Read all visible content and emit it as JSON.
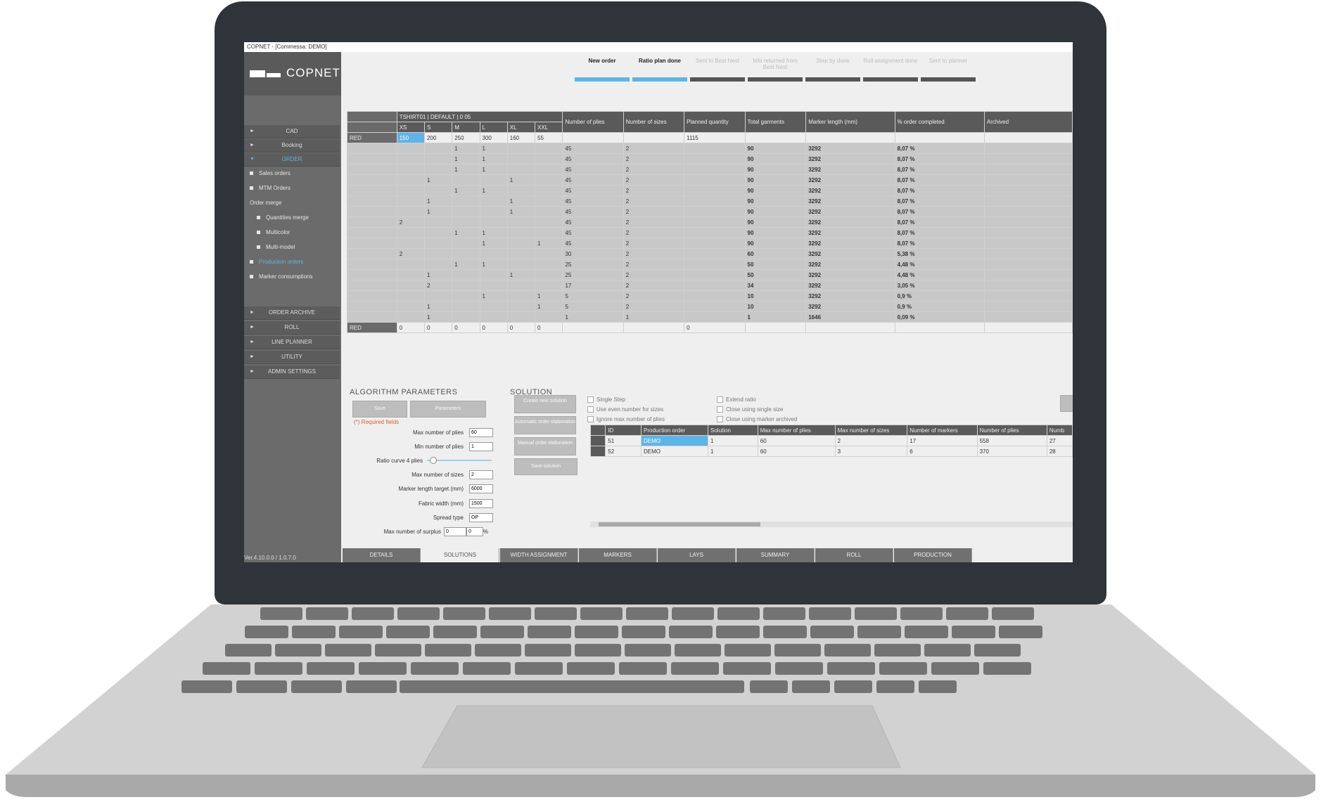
{
  "window_title": "COPNET - [Commessa: DEMO]",
  "brand": "COPNET",
  "version": "Ver.4.10.0.0 / 1.0.7.0",
  "sidebar": {
    "cad": "CAD",
    "booking": "Booking",
    "order": "ORDER",
    "sales_orders": "Sales orders",
    "mtm_orders": "MTM Orders",
    "order_merge": "Order merge",
    "quantities_merge": "Quantities merge",
    "multicolor": "Multicolor",
    "multi_model": "Multi-model",
    "production_orders": "Production orders",
    "marker_consumptions": "Marker consumptions",
    "order_archive": "ORDER ARCHIVE",
    "roll": "ROLL",
    "line_planner": "LINE PLANNER",
    "utility": "UTILITY",
    "admin_settings": "ADMIN SETTINGS"
  },
  "steps": [
    "New order",
    "Ratio plan done",
    "Sent to Best Nest",
    "Info returned from Best Nest",
    "Step by done",
    "Roll assignment done",
    "Sent to planner"
  ],
  "grid": {
    "group_header": "TSHIRT01 | DEFAULT | 0 05",
    "sizes": [
      "XS",
      "S",
      "M",
      "L",
      "XL",
      "XXL"
    ],
    "columns": [
      "Number of plies",
      "Number of sizes",
      "Planned quantity",
      "Total garments",
      "Marker length (mm)",
      "% order completed",
      "Archived"
    ],
    "order_row": {
      "label": "RED",
      "qty": [
        "150",
        "200",
        "250",
        "300",
        "160",
        "55"
      ],
      "planned": "1115"
    },
    "rows": [
      [
        "",
        "",
        "1",
        "1",
        "",
        "",
        "45",
        "2",
        "",
        "90",
        "3292",
        "8,07 %"
      ],
      [
        "",
        "",
        "1",
        "1",
        "",
        "",
        "45",
        "2",
        "",
        "90",
        "3292",
        "8,07 %"
      ],
      [
        "",
        "",
        "1",
        "1",
        "",
        "",
        "45",
        "2",
        "",
        "90",
        "3292",
        "8,07 %"
      ],
      [
        "",
        "1",
        "",
        "",
        "1",
        "",
        "45",
        "2",
        "",
        "90",
        "3292",
        "8,07 %"
      ],
      [
        "",
        "",
        "1",
        "1",
        "",
        "",
        "45",
        "2",
        "",
        "90",
        "3292",
        "8,07 %"
      ],
      [
        "",
        "1",
        "",
        "",
        "1",
        "",
        "45",
        "2",
        "",
        "90",
        "3292",
        "8,07 %"
      ],
      [
        "",
        "1",
        "",
        "",
        "1",
        "",
        "45",
        "2",
        "",
        "90",
        "3292",
        "8,07 %"
      ],
      [
        "2",
        "",
        "",
        "",
        "",
        "",
        "45",
        "2",
        "",
        "90",
        "3292",
        "8,07 %"
      ],
      [
        "",
        "",
        "1",
        "1",
        "",
        "",
        "45",
        "2",
        "",
        "90",
        "3292",
        "8,07 %"
      ],
      [
        "",
        "",
        "",
        "1",
        "",
        "1",
        "45",
        "2",
        "",
        "90",
        "3292",
        "8,07 %"
      ],
      [
        "2",
        "",
        "",
        "",
        "",
        "",
        "30",
        "2",
        "",
        "60",
        "3292",
        "5,38 %"
      ],
      [
        "",
        "",
        "1",
        "1",
        "",
        "",
        "25",
        "2",
        "",
        "50",
        "3292",
        "4,48 %"
      ],
      [
        "",
        "1",
        "",
        "",
        "1",
        "",
        "25",
        "2",
        "",
        "50",
        "3292",
        "4,48 %"
      ],
      [
        "",
        "2",
        "",
        "",
        "",
        "",
        "17",
        "2",
        "",
        "34",
        "3292",
        "3,05 %"
      ],
      [
        "",
        "",
        "",
        "1",
        "",
        "1",
        "5",
        "2",
        "",
        "10",
        "3292",
        "0,9 %"
      ],
      [
        "",
        "1",
        "",
        "",
        "",
        "1",
        "5",
        "2",
        "",
        "10",
        "3292",
        "0,9 %"
      ],
      [
        "",
        "1",
        "",
        "",
        "",
        "",
        "1",
        "1",
        "",
        "1",
        "1646",
        "0,09 %"
      ]
    ],
    "total_row": {
      "label": "RED",
      "qty": [
        "0",
        "0",
        "0",
        "0",
        "0",
        "0"
      ],
      "planned": "0"
    }
  },
  "algorithm": {
    "title": "ALGORITHM PARAMETERS",
    "save": "Save",
    "parameters": "Parameters",
    "required": "(*) Required fields",
    "max_plies_label": "Max number of plies",
    "max_plies": "60",
    "min_plies_label": "Min number of plies",
    "min_plies": "1",
    "ratio_label": "Ratio curve 4 plies",
    "max_sizes_label": "Max number of sizes",
    "max_sizes": "2",
    "marker_len_label": "Marker length target (mm)",
    "marker_len": "6000",
    "fabric_label": "Fabric width (mm)",
    "fabric": "1500",
    "spread_label": "Spread type",
    "spread": "OP",
    "surplus_label": "Max number of surplus",
    "surplus": "0",
    "surplus_pct": "0",
    "pct": "%"
  },
  "solution": {
    "title": "SOLUTION",
    "create": "Create new solution",
    "auto": "Automatic order elaboration",
    "manual": "Manual order elaboration",
    "save": "Save solution",
    "opts_left": [
      "Single Step",
      "Use even number for sizes",
      "Ignore max number of plies"
    ],
    "opts_right": [
      "Extend ratio",
      "Close using single size",
      "Close using marker archived"
    ],
    "columns": [
      "ID",
      "Production order",
      "Solution",
      "Max number of plies",
      "Max number of sizes",
      "Number of markers",
      "Number of plies",
      "Numb"
    ],
    "rows": [
      [
        "51",
        "DEMO",
        "1",
        "60",
        "2",
        "17",
        "558",
        "27"
      ],
      [
        "52",
        "DEMO",
        "1",
        "60",
        "3",
        "6",
        "370",
        "28"
      ]
    ]
  },
  "tabs": [
    "DETAILS",
    "SOLUTIONS",
    "WIDTH ASSIGNMENT",
    "MARKERS",
    "LAYS",
    "SUMMARY",
    "ROLL",
    "PRODUCTION"
  ]
}
